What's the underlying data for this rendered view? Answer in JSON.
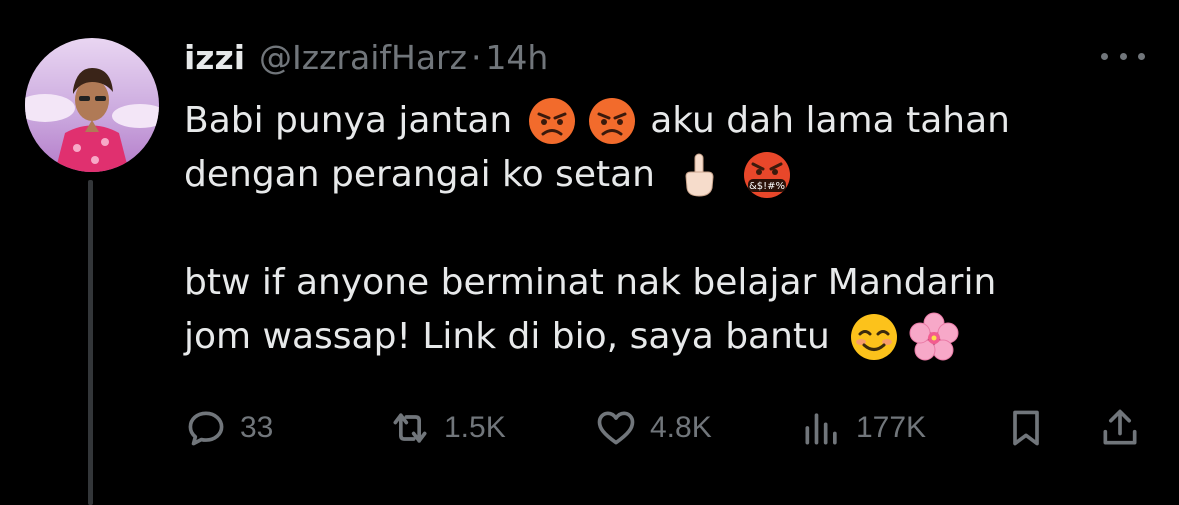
{
  "tweet": {
    "display_name": "izzi",
    "handle": "@IzzraifHarz",
    "separator": "·",
    "time": "14h",
    "lines": [
      "Babi punya jantan",
      "aku dah lama tahan",
      "dengan perangai ko setan",
      "btw if anyone berminat nak belajar Mandarin",
      "jom wassap! Link di bio, saya bantu"
    ],
    "emojis": {
      "angry": "angry-face",
      "middle_finger": "middle-finger",
      "cursing": "face-with-symbols-on-mouth",
      "cursing_symbols": "&$!#%",
      "smile": "smiling-face",
      "flower": "cherry-blossom"
    }
  },
  "actions": {
    "replies": "33",
    "reposts": "1.5K",
    "likes": "4.8K",
    "views": "177K"
  },
  "colors": {
    "background": "#000000",
    "text_primary": "#e7e9ea",
    "text_secondary": "#71767b",
    "thread_line": "#333639"
  }
}
